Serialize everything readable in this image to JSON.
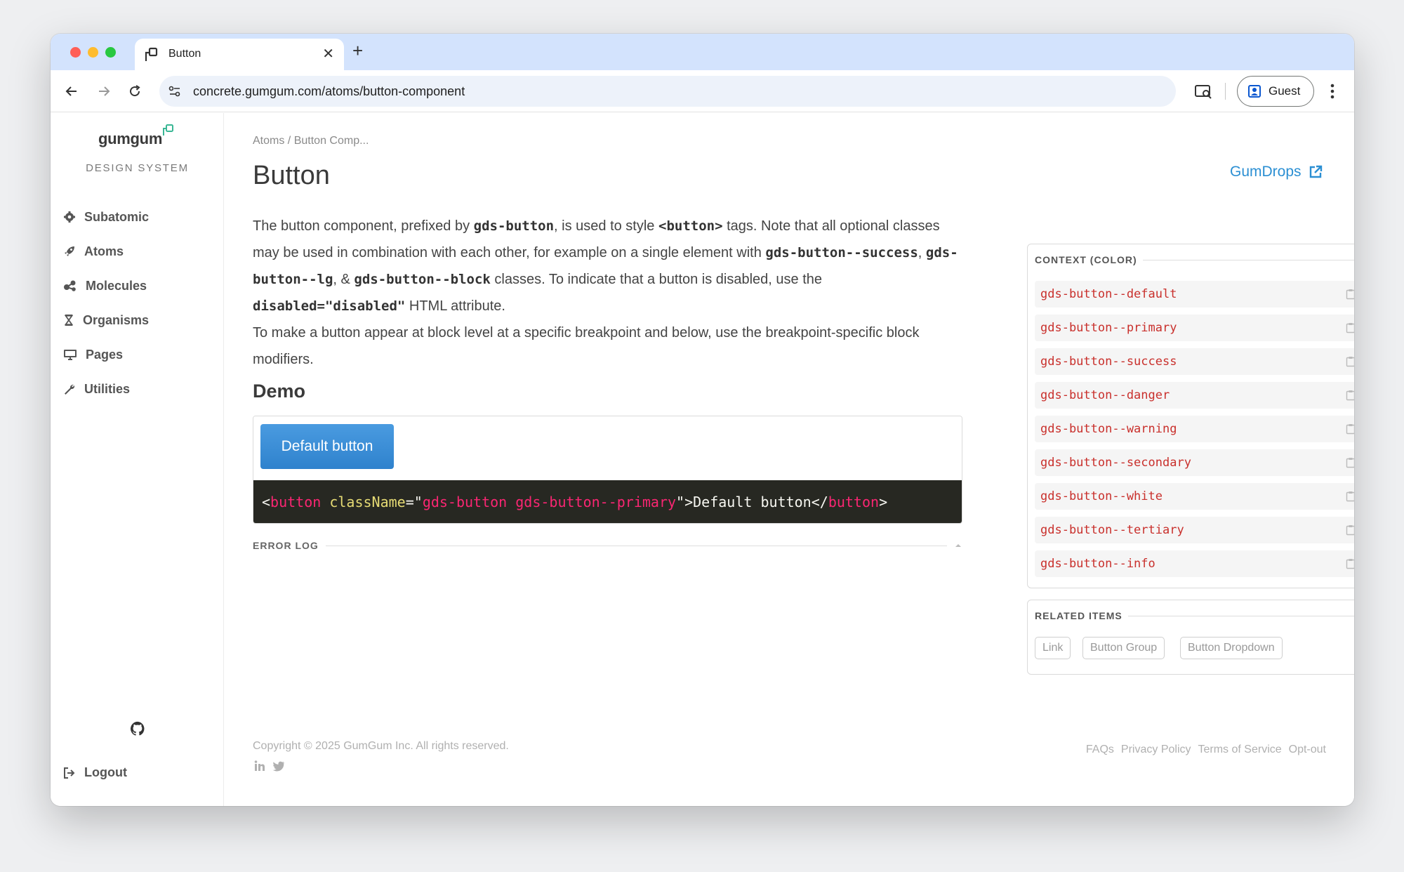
{
  "browser": {
    "tab_title": "Button",
    "url_host": "concrete.gumgum.com",
    "url_path": "/atoms/button-component",
    "profile_label": "Guest",
    "new_tab_symbol": "+",
    "close_symbol": "✕"
  },
  "sidebar": {
    "logo_text": "gumgum",
    "subtitle": "DESIGN SYSTEM",
    "items": [
      {
        "label": "Subatomic",
        "icon": "gear-icon"
      },
      {
        "label": "Atoms",
        "icon": "rocket-icon"
      },
      {
        "label": "Molecules",
        "icon": "molecule-icon"
      },
      {
        "label": "Organisms",
        "icon": "hourglass-icon"
      },
      {
        "label": "Pages",
        "icon": "monitor-icon"
      },
      {
        "label": "Utilities",
        "icon": "wrench-icon"
      }
    ],
    "logout_label": "Logout"
  },
  "breadcrumb": {
    "root": "Atoms",
    "separator": "/",
    "current": "Button Comp..."
  },
  "page": {
    "title": "Button",
    "gumdrops_label": "GumDrops",
    "desc": {
      "p1_a": "The button component, prefixed by ",
      "p1_code1": "gds-button",
      "p1_b": ", is used to style ",
      "p1_code2": "<button>",
      "p1_c": " tags. Note that all optional classes may be used in combination with each other, for example on a single element with ",
      "p1_code3": "gds-button--success",
      "p1_d": ", ",
      "p1_code4": "gds-button--lg",
      "p1_e": ", & ",
      "p1_code5": "gds-button--block",
      "p1_f": " classes. To indicate that a button is disabled, use the ",
      "p1_code6": "disabled=\"disabled\"",
      "p1_g": " HTML attribute.",
      "p2": "To make a button appear at block level at a specific breakpoint and below, use the breakpoint-specific block modifiers."
    },
    "demo_heading": "Demo",
    "demo_button_label": "Default button",
    "code": {
      "open_lt": "<",
      "tag": "button",
      "space": " ",
      "attr": "className",
      "eq_quote": "=\"",
      "value": "gds-button gds-button--primary",
      "close_quote_gt": "\">",
      "text": "Default button",
      "close_lt": "</",
      "close_tag": "button",
      "close_gt": ">"
    },
    "error_log_label": "ERROR LOG"
  },
  "context_panel": {
    "title": "CONTEXT (COLOR)",
    "items": [
      "gds-button--default",
      "gds-button--primary",
      "gds-button--success",
      "gds-button--danger",
      "gds-button--warning",
      "gds-button--secondary",
      "gds-button--white",
      "gds-button--tertiary",
      "gds-button--info"
    ]
  },
  "related_panel": {
    "title": "RELATED ITEMS",
    "items": [
      "Link",
      "Button Group",
      "Button Dropdown"
    ]
  },
  "footer": {
    "copyright": "Copyright © 2025 GumGum Inc. All rights reserved.",
    "links": [
      "FAQs",
      "Privacy Policy",
      "Terms of Service",
      "Opt-out"
    ]
  },
  "colors": {
    "accent": "#2b8fd3",
    "primary_button": "#3a8fd6",
    "code_background": "#272822",
    "class_name_red": "#c9302c",
    "logo_green": "#3ab795"
  }
}
